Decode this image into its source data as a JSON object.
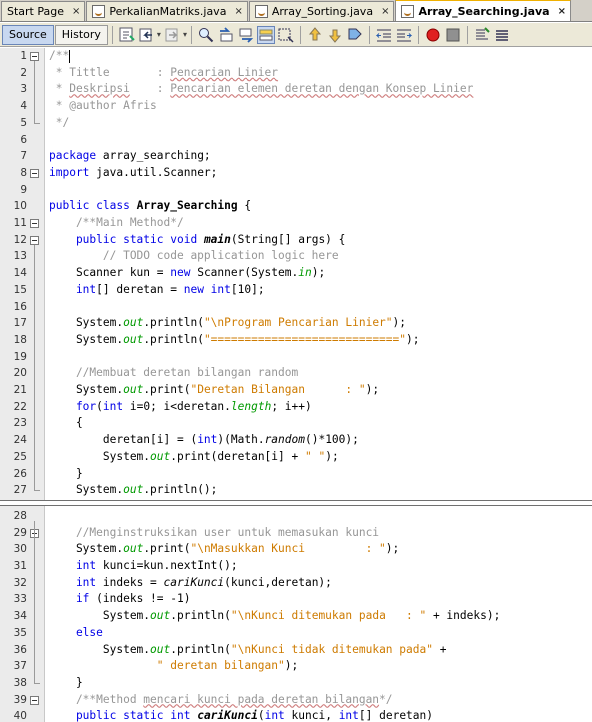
{
  "tabs": [
    {
      "label": "Start Page",
      "icon": "start-page-icon",
      "active": false
    },
    {
      "label": "PerkalianMatriks.java",
      "icon": "java-file-icon",
      "active": false
    },
    {
      "label": "Array_Sorting.java",
      "icon": "java-file-icon",
      "active": false
    },
    {
      "label": "Array_Searching.java",
      "icon": "java-file-icon",
      "active": true
    }
  ],
  "tab_close_glyph": "×",
  "toolbar": {
    "source_label": "Source",
    "history_label": "History",
    "icons": [
      "back-icon",
      "forward-icon",
      "last-edit-icon",
      "find-icon",
      "find-previous-icon",
      "find-next-icon",
      "toggle-highlight-icon",
      "toggle-rectangular-selection-icon",
      "previous-bookmark-icon",
      "next-bookmark-icon",
      "toggle-bookmark-icon",
      "shift-left-icon",
      "shift-right-icon",
      "start-macro-icon",
      "stop-macro-icon",
      "comment-icon",
      "uncomment-icon"
    ]
  },
  "colors": {
    "keyword": "#0000e6",
    "string": "#ce7b00",
    "comment": "#969696",
    "field": "#009900",
    "active_tab_accent": "#f0b000"
  },
  "code_lines_a": [
    {
      "n": "1",
      "segs": [
        [
          "cmt",
          "/**"
        ]
      ]
    },
    {
      "n": "2",
      "segs": [
        [
          "cmt",
          " * Tittle       : "
        ],
        [
          "cmt sq",
          "Pencarian Linier"
        ]
      ]
    },
    {
      "n": "3",
      "segs": [
        [
          "cmt",
          " * "
        ],
        [
          "cmt sq",
          "Deskripsi"
        ],
        [
          "cmt",
          "    : "
        ],
        [
          "cmt sq",
          "Pencarian elemen deretan dengan Konsep Linier"
        ]
      ]
    },
    {
      "n": "4",
      "segs": [
        [
          "cmt",
          " * @author Afris"
        ]
      ]
    },
    {
      "n": "5",
      "segs": [
        [
          "cmt",
          " */"
        ]
      ]
    },
    {
      "n": "6",
      "segs": []
    },
    {
      "n": "7",
      "segs": [
        [
          "kw",
          "package"
        ],
        [
          "",
          " array_searching;"
        ]
      ]
    },
    {
      "n": "8",
      "segs": [
        [
          "kw",
          "import"
        ],
        [
          "",
          " java.util.Scanner;"
        ]
      ]
    },
    {
      "n": "9",
      "segs": []
    },
    {
      "n": "10",
      "segs": [
        [
          "kw",
          "public class"
        ],
        [
          "",
          " "
        ],
        [
          "bld",
          "Array_Searching"
        ],
        [
          "",
          " {"
        ]
      ]
    },
    {
      "n": "11",
      "segs": [
        [
          "cmt",
          "    /**Main Method*/"
        ]
      ]
    },
    {
      "n": "12",
      "segs": [
        [
          "kw",
          "    public static void"
        ],
        [
          "",
          " "
        ],
        [
          "mth",
          "main"
        ],
        [
          "",
          "(String[] args) {"
        ]
      ]
    },
    {
      "n": "13",
      "segs": [
        [
          "cmt",
          "        // TODO code application logic here"
        ]
      ]
    },
    {
      "n": "14",
      "segs": [
        [
          "",
          "    Scanner kun = "
        ],
        [
          "kw",
          "new"
        ],
        [
          "",
          " Scanner(System."
        ],
        [
          "fld",
          "in"
        ],
        [
          "",
          ");"
        ]
      ]
    },
    {
      "n": "15",
      "segs": [
        [
          "kw",
          "    int"
        ],
        [
          "",
          "[] deretan = "
        ],
        [
          "kw",
          "new int"
        ],
        [
          "",
          "[10];"
        ]
      ]
    },
    {
      "n": "16",
      "segs": []
    },
    {
      "n": "17",
      "segs": [
        [
          "",
          "    System."
        ],
        [
          "fld",
          "out"
        ],
        [
          "",
          ".println("
        ],
        [
          "str",
          "\"\\nProgram Pencarian Linier\""
        ],
        [
          "",
          ");"
        ]
      ]
    },
    {
      "n": "18",
      "segs": [
        [
          "",
          "    System."
        ],
        [
          "fld",
          "out"
        ],
        [
          "",
          ".println("
        ],
        [
          "str",
          "\"============================\""
        ],
        [
          "",
          ");"
        ]
      ]
    },
    {
      "n": "19",
      "segs": []
    },
    {
      "n": "20",
      "segs": [
        [
          "cmt",
          "    //Membuat deretan bilangan random"
        ]
      ]
    },
    {
      "n": "21",
      "segs": [
        [
          "",
          "    System."
        ],
        [
          "fld",
          "out"
        ],
        [
          "",
          ".print("
        ],
        [
          "str",
          "\"Deretan Bilangan      : \""
        ],
        [
          "",
          ");"
        ]
      ]
    },
    {
      "n": "22",
      "segs": [
        [
          "kw",
          "    for"
        ],
        [
          "",
          "("
        ],
        [
          "kw",
          "int"
        ],
        [
          "",
          " i=0; i<deretan."
        ],
        [
          "fld",
          "length"
        ],
        [
          "",
          "; i++)"
        ]
      ]
    },
    {
      "n": "23",
      "segs": [
        [
          "",
          "    {"
        ]
      ]
    },
    {
      "n": "24",
      "segs": [
        [
          "",
          "        deretan[i] = ("
        ],
        [
          "kw",
          "int"
        ],
        [
          "",
          ")(Math."
        ],
        [
          "sm",
          "random"
        ],
        [
          "",
          "()*100);"
        ]
      ]
    },
    {
      "n": "25",
      "segs": [
        [
          "",
          "        System."
        ],
        [
          "fld",
          "out"
        ],
        [
          "",
          ".print(deretan[i] + "
        ],
        [
          "str",
          "\" \""
        ],
        [
          "",
          ");"
        ]
      ]
    },
    {
      "n": "26",
      "segs": [
        [
          "",
          "    }"
        ]
      ]
    },
    {
      "n": "27",
      "segs": [
        [
          "",
          "    System."
        ],
        [
          "fld",
          "out"
        ],
        [
          "",
          ".println();"
        ]
      ]
    }
  ],
  "code_lines_b": [
    {
      "n": "28",
      "segs": []
    },
    {
      "n": "29",
      "segs": [
        [
          "cmt",
          "    //Menginstruksikan user untuk memasukan kunci"
        ]
      ]
    },
    {
      "n": "30",
      "segs": [
        [
          "",
          "    System."
        ],
        [
          "fld",
          "out"
        ],
        [
          "",
          ".print("
        ],
        [
          "str",
          "\"\\nMasukkan Kunci         : \""
        ],
        [
          "",
          ");"
        ]
      ]
    },
    {
      "n": "31",
      "segs": [
        [
          "kw",
          "    int"
        ],
        [
          "",
          " kunci=kun.nextInt();"
        ]
      ]
    },
    {
      "n": "32",
      "segs": [
        [
          "kw",
          "    int"
        ],
        [
          "",
          " indeks = "
        ],
        [
          "sm",
          "cariKunci"
        ],
        [
          "",
          "(kunci,deretan);"
        ]
      ]
    },
    {
      "n": "33",
      "segs": [
        [
          "kw",
          "    if"
        ],
        [
          "",
          " (indeks != -1)"
        ]
      ]
    },
    {
      "n": "34",
      "segs": [
        [
          "",
          "        System."
        ],
        [
          "fld",
          "out"
        ],
        [
          "",
          ".println("
        ],
        [
          "str",
          "\"\\nKunci ditemukan pada   : \""
        ],
        [
          "",
          " + indeks);"
        ]
      ]
    },
    {
      "n": "35",
      "segs": [
        [
          "kw",
          "    else"
        ]
      ]
    },
    {
      "n": "36",
      "segs": [
        [
          "",
          "        System."
        ],
        [
          "fld",
          "out"
        ],
        [
          "",
          ".println("
        ],
        [
          "str",
          "\"\\nKunci tidak ditemukan pada\""
        ],
        [
          "",
          " +"
        ]
      ]
    },
    {
      "n": "37",
      "segs": [
        [
          "str",
          "                \" deretan bilangan\""
        ],
        [
          "",
          ");"
        ]
      ]
    },
    {
      "n": "38",
      "segs": [
        [
          "",
          "    }"
        ]
      ]
    },
    {
      "n": "39",
      "segs": [
        [
          "cmt",
          "    /**Method "
        ],
        [
          "cmt sq",
          "mencari kunci pada deretan bilangan"
        ],
        [
          "cmt",
          "*/"
        ]
      ]
    },
    {
      "n": "40",
      "segs": [
        [
          "kw",
          "    public static int"
        ],
        [
          "",
          " "
        ],
        [
          "mth",
          "cariKunci"
        ],
        [
          "",
          "("
        ],
        [
          "kw",
          "int"
        ],
        [
          "",
          " kunci, "
        ],
        [
          "kw",
          "int"
        ],
        [
          "",
          "[] deretan)"
        ]
      ]
    }
  ]
}
